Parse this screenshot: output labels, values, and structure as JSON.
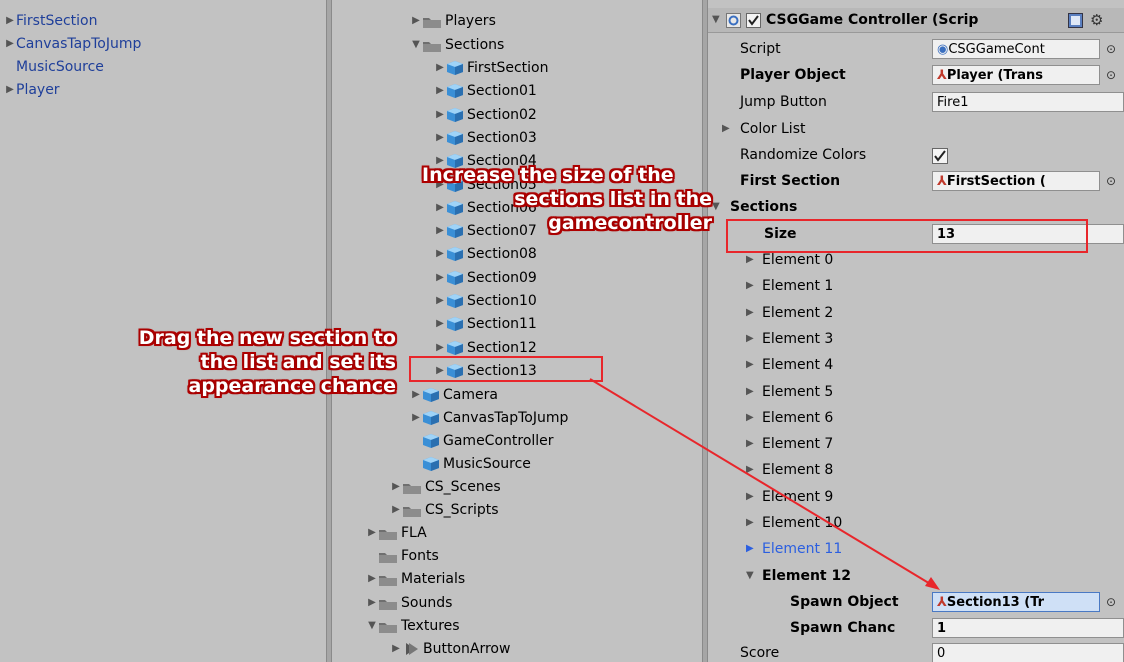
{
  "hierarchy": {
    "items": [
      {
        "label": "FirstSection",
        "expandable": true
      },
      {
        "label": "CanvasTapToJump",
        "expandable": true
      },
      {
        "label": "MusicSource",
        "expandable": false
      },
      {
        "label": "Player",
        "expandable": true
      }
    ]
  },
  "project": {
    "players": "Players",
    "sections": "Sections",
    "section_items": [
      "FirstSection",
      "Section01",
      "Section02",
      "Section03",
      "Section04",
      "Section05",
      "Section06",
      "Section07",
      "Section08",
      "Section09",
      "Section10",
      "Section11",
      "Section12",
      "Section13"
    ],
    "camera": "Camera",
    "canvas": "CanvasTapToJump",
    "gamecontroller": "GameController",
    "music": "MusicSource",
    "cs_scenes": "CS_Scenes",
    "cs_scripts": "CS_Scripts",
    "fla": "FLA",
    "fonts": "Fonts",
    "materials": "Materials",
    "sounds": "Sounds",
    "textures": "Textures",
    "buttonarrow": "ButtonArrow"
  },
  "inspector": {
    "component_title": "CSGGame Controller (Scrip",
    "script_label": "Script",
    "script_value": "CSGGameCont",
    "player_object_label": "Player Object",
    "player_object_value": "Player (Trans",
    "jump_button_label": "Jump Button",
    "jump_button_value": "Fire1",
    "color_list_label": "Color List",
    "randomize_label": "Randomize Colors",
    "first_section_label": "First Section",
    "first_section_value": "FirstSection (",
    "sections_label": "Sections",
    "size_label": "Size",
    "size_value": "13",
    "elements": [
      "Element 0",
      "Element 1",
      "Element 2",
      "Element 3",
      "Element 4",
      "Element 5",
      "Element 6",
      "Element 7",
      "Element 8",
      "Element 9",
      "Element 10",
      "Element 11"
    ],
    "element12_label": "Element 12",
    "spawn_object_label": "Spawn Object",
    "spawn_object_value": "Section13 (Tr",
    "spawn_chance_label": "Spawn Chanc",
    "spawn_chance_value": "1",
    "score_label": "Score",
    "score_value": "0",
    "picker_glyph": "⊙",
    "checkmark": "✔"
  },
  "annotations": {
    "top_lines": [
      "Increase the size of the",
      "sections list in the",
      "gamecontroller"
    ],
    "left_lines": [
      "Drag the new section to",
      "the list and set its",
      "appearance chance"
    ]
  },
  "colors": {
    "panel_bg": "#c2c2c2",
    "annotation_red": "#e8262b",
    "hierarchy_blue": "#1f3f9a",
    "selected_blue": "#2b5fe0"
  }
}
